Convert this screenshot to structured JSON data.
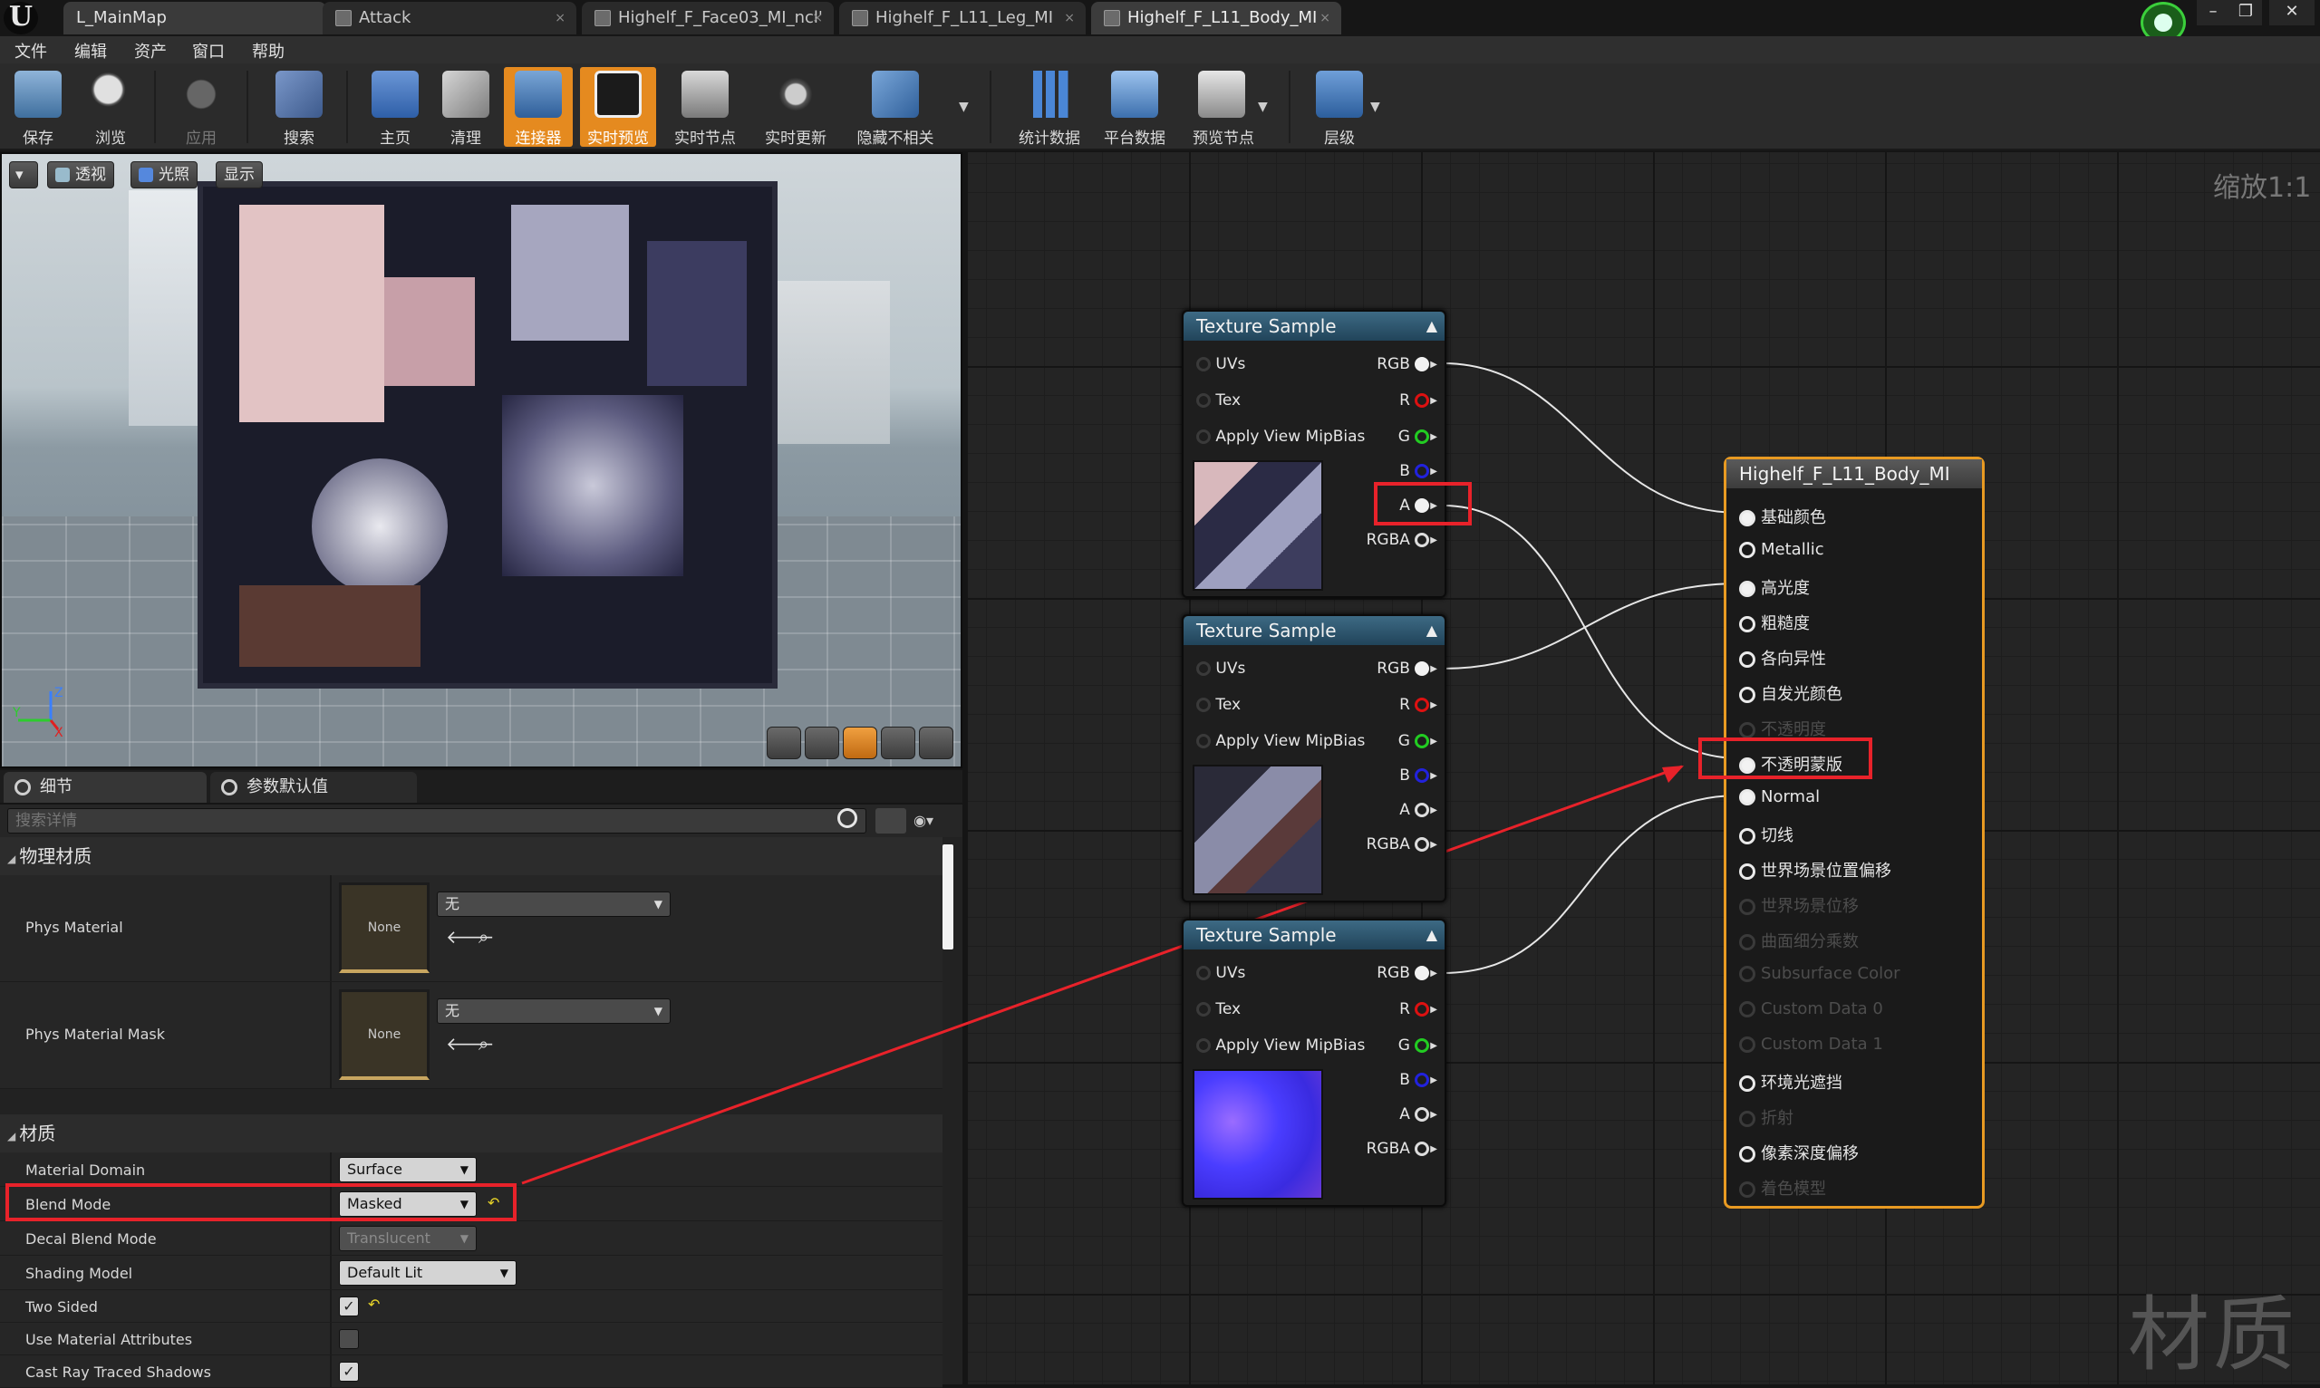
{
  "tabs": [
    {
      "label": "L_MainMap"
    },
    {
      "label": "Attack"
    },
    {
      "label": "Highelf_F_Face03_MI_ncl'"
    },
    {
      "label": "Highelf_F_L11_Leg_MI"
    },
    {
      "label": "Highelf_F_L11_Body_MI"
    }
  ],
  "tab_close": "×",
  "menu": [
    "文件",
    "编辑",
    "资产",
    "窗口",
    "帮助"
  ],
  "toolbar": [
    "保存",
    "浏览",
    "应用",
    "搜索",
    "主页",
    "清理",
    "连接器",
    "实时预览",
    "实时节点",
    "实时更新",
    "隐藏不相关",
    "统计数据",
    "平台数据",
    "预览节点",
    "层级"
  ],
  "viewport": {
    "tools": [
      "透视",
      "光照",
      "显示"
    ],
    "axes": {
      "z": "Z",
      "x": "X",
      "y": "Y"
    }
  },
  "details": {
    "tabs": [
      "细节",
      "参数默认值"
    ],
    "search_placeholder": "搜索详情",
    "cat_phys": "物理材质",
    "cat_material": "材质",
    "phys_material": {
      "label": "Phys Material",
      "thumb": "None",
      "value": "无"
    },
    "phys_mask": {
      "label": "Phys Material Mask",
      "thumb": "None",
      "value": "无"
    },
    "rows": {
      "material_domain": {
        "label": "Material Domain",
        "value": "Surface"
      },
      "blend_mode": {
        "label": "Blend Mode",
        "value": "Masked"
      },
      "decal_blend": {
        "label": "Decal Blend Mode",
        "value": "Translucent"
      },
      "shading_model": {
        "label": "Shading Model",
        "value": "Default Lit"
      },
      "two_sided": {
        "label": "Two Sided",
        "checked": true
      },
      "use_attrs": {
        "label": "Use Material Attributes",
        "checked": false
      },
      "cast_ray": {
        "label": "Cast Ray Traced Shadows",
        "checked": true
      }
    }
  },
  "graph": {
    "zoom": "缩放1:1",
    "watermark": "材质",
    "node_title": "Texture Sample",
    "inputs": [
      "UVs",
      "Tex",
      "Apply View MipBias"
    ],
    "outputs": [
      "RGB",
      "R",
      "G",
      "B",
      "A",
      "RGBA"
    ],
    "result": {
      "title": "Highelf_F_L11_Body_MI",
      "pins": [
        {
          "label": "基础颜色",
          "dim": false,
          "fill": true
        },
        {
          "label": "Metallic",
          "dim": false,
          "fill": false
        },
        {
          "label": "高光度",
          "dim": false,
          "fill": true
        },
        {
          "label": "粗糙度",
          "dim": false,
          "fill": false
        },
        {
          "label": "各向异性",
          "dim": false,
          "fill": false
        },
        {
          "label": "自发光颜色",
          "dim": false,
          "fill": false
        },
        {
          "label": "不透明度",
          "dim": true,
          "fill": false
        },
        {
          "label": "不透明蒙版",
          "dim": false,
          "fill": true
        },
        {
          "label": "Normal",
          "dim": false,
          "fill": true
        },
        {
          "label": "切线",
          "dim": false,
          "fill": false
        },
        {
          "label": "世界场景位置偏移",
          "dim": false,
          "fill": false
        },
        {
          "label": "世界场景位移",
          "dim": true,
          "fill": false
        },
        {
          "label": "曲面细分乘数",
          "dim": true,
          "fill": false
        },
        {
          "label": "Subsurface Color",
          "dim": true,
          "fill": false
        },
        {
          "label": "Custom Data 0",
          "dim": true,
          "fill": false
        },
        {
          "label": "Custom Data 1",
          "dim": true,
          "fill": false
        },
        {
          "label": "环境光遮挡",
          "dim": false,
          "fill": false
        },
        {
          "label": "折射",
          "dim": true,
          "fill": false
        },
        {
          "label": "像素深度偏移",
          "dim": false,
          "fill": false
        },
        {
          "label": "着色模型",
          "dim": true,
          "fill": false
        }
      ]
    }
  },
  "colors": {
    "accent_orange": "#e58a1f",
    "highlight_red": "#e8222a",
    "node_header": "#2e5a74"
  }
}
